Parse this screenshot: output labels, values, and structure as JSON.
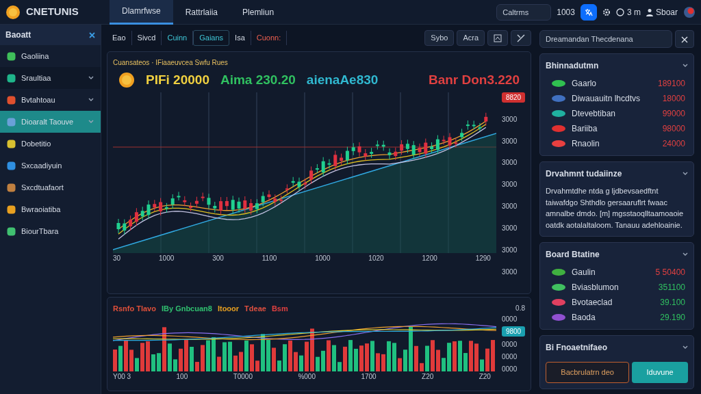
{
  "app": {
    "logo_text": "CNETUNIS"
  },
  "nav_tabs": [
    {
      "label": "Dlamrfwse",
      "selected": true
    },
    {
      "label": "Rattrlaiia",
      "selected": false
    },
    {
      "label": "Plemliun",
      "selected": false
    }
  ],
  "search": {
    "placeholder": "Caltrms",
    "shortcut": "1003"
  },
  "header_right": {
    "count": "3 m",
    "user": "Sboar"
  },
  "sidebar": {
    "title": "Baoatt",
    "items": [
      {
        "label": "Gaoliina",
        "color": "#3fbf5a",
        "expandable": false,
        "selected": false
      },
      {
        "label": "Sraultiaa",
        "color": "#1fb58a",
        "expandable": true,
        "selected": false
      },
      {
        "label": "Bvtahtoau",
        "color": "#e0502e",
        "expandable": true,
        "selected": false
      },
      {
        "label": "Dioaralt Taouve",
        "color": "#6aa0d8",
        "expandable": true,
        "selected": true
      },
      {
        "label": "Dobetitio",
        "color": "#d8c030",
        "expandable": false,
        "selected": false
      },
      {
        "label": "Sxcaadiyuin",
        "color": "#2f8fe0",
        "expandable": false,
        "selected": false
      },
      {
        "label": "Sxcdtuafaort",
        "color": "#c08040",
        "expandable": false,
        "selected": false
      },
      {
        "label": "Bwraoiatiba",
        "color": "#e8a020",
        "expandable": false,
        "selected": false
      },
      {
        "label": "BiourTbara",
        "color": "#40c070",
        "expandable": false,
        "selected": false
      }
    ]
  },
  "toolbar": {
    "tabs": [
      {
        "label": "Eao",
        "kind": "plain",
        "selected": false
      },
      {
        "label": "Sivcd",
        "kind": "plain",
        "selected": false
      },
      {
        "label": "Cuinn",
        "kind": "cyan",
        "selected": false
      },
      {
        "label": "Gaians",
        "kind": "cyan",
        "selected": true
      },
      {
        "label": "Isa",
        "kind": "plain",
        "selected": false
      },
      {
        "label": "Cuonn:",
        "kind": "red",
        "selected": false
      }
    ],
    "buttons": [
      "Sybo",
      "Acra"
    ]
  },
  "chart": {
    "subtitle": "Cuansateos · IFiaaeuvcea Swfu Rues",
    "symbol": "PIFi 20000",
    "stats": [
      {
        "text": "Aima 230.20",
        "color": "#30c060"
      },
      {
        "text": "aienaAe830",
        "color": "#30b8d0"
      },
      {
        "text": "Banr Don3.220",
        "color": "#e04040"
      }
    ],
    "price_tag": "8820",
    "y_labels": [
      "3000",
      "3000",
      "3000",
      "3000",
      "3000",
      "3000",
      "3000",
      "3000"
    ],
    "x_labels": [
      "30",
      "1000",
      "300",
      "1100",
      "1000",
      "1020",
      "1200",
      "1290"
    ]
  },
  "volume_chart": {
    "legend": [
      {
        "text": "Rsnfo Tlavo",
        "color": "#e0503a"
      },
      {
        "text": "IBy Gnbcuan8",
        "color": "#30c070"
      },
      {
        "text": "Itooor",
        "color": "#e8a020"
      },
      {
        "text": "Tdeae",
        "color": "#e05040"
      },
      {
        "text": "Bsm",
        "color": "#e04040"
      }
    ],
    "corner": "0.8",
    "price_tag": "9800",
    "y_labels": [
      "0000",
      "0000",
      "0000",
      "0000"
    ],
    "x_labels": [
      "Y00 3",
      "100",
      "T0000",
      "%000",
      "1700",
      "Z20",
      "Z20"
    ]
  },
  "side_search": {
    "placeholder": "Dreamandan Thecdenana"
  },
  "watchlist": {
    "title": "Bhinnadutmn",
    "items": [
      {
        "name": "Gaarlo",
        "icon": {
          "color": "#30c050"
        },
        "value": {
          "text": "189100",
          "color": "#e04040"
        }
      },
      {
        "name": "Diwauauitn lhcdtvs",
        "icon": {
          "color": "#4070c0"
        },
        "value": {
          "text": "18000",
          "color": "#e04040"
        }
      },
      {
        "name": "Dtevebtiban",
        "icon": {
          "color": "#20b0a0"
        },
        "value": {
          "text": "99000",
          "color": "#e04040"
        }
      },
      {
        "name": "Bariiba",
        "icon": {
          "color": "#e03030"
        },
        "value": {
          "text": "98000",
          "color": "#e04040"
        }
      },
      {
        "name": "Rnaolin",
        "icon": {
          "color": "#e84040"
        },
        "value": {
          "text": "24000",
          "color": "#e04040"
        }
      }
    ]
  },
  "description": {
    "title": "Drvahmnt tudaiinze",
    "text": "Drvahmtdhe ntda g ljdbevsaedftnt taiwafdgo Shthdlo gersaaruflrt fwaac amnalbe dmdo. [m] mgsstaoqlltaamoaoie oatdk aotalaltaloom. Tanauu adehloainie."
  },
  "board": {
    "title": "Board Btatine",
    "items": [
      {
        "name": "Gaulin",
        "icon": {
          "color": "#40b040"
        },
        "value": {
          "text": "5 50400",
          "color": "#e04040"
        }
      },
      {
        "name": "Bviasblumon",
        "icon": {
          "color": "#40c060"
        },
        "value": {
          "text": "351100",
          "color": "#30c060"
        }
      },
      {
        "name": "Bvotaeclad",
        "icon": {
          "color": "#e04060"
        },
        "value": {
          "text": "39.100",
          "color": "#30c060"
        }
      },
      {
        "name": "Baoda",
        "icon": {
          "color": "#9050d0"
        },
        "value": {
          "text": "29.190",
          "color": "#30c060"
        }
      }
    ]
  },
  "actions": {
    "title": "Bi Fnoaetnifaeo",
    "buttons": [
      {
        "label": "Bacbrulatrn deo",
        "kind": "outline"
      },
      {
        "label": "Iduvune",
        "kind": "primary"
      }
    ]
  }
}
